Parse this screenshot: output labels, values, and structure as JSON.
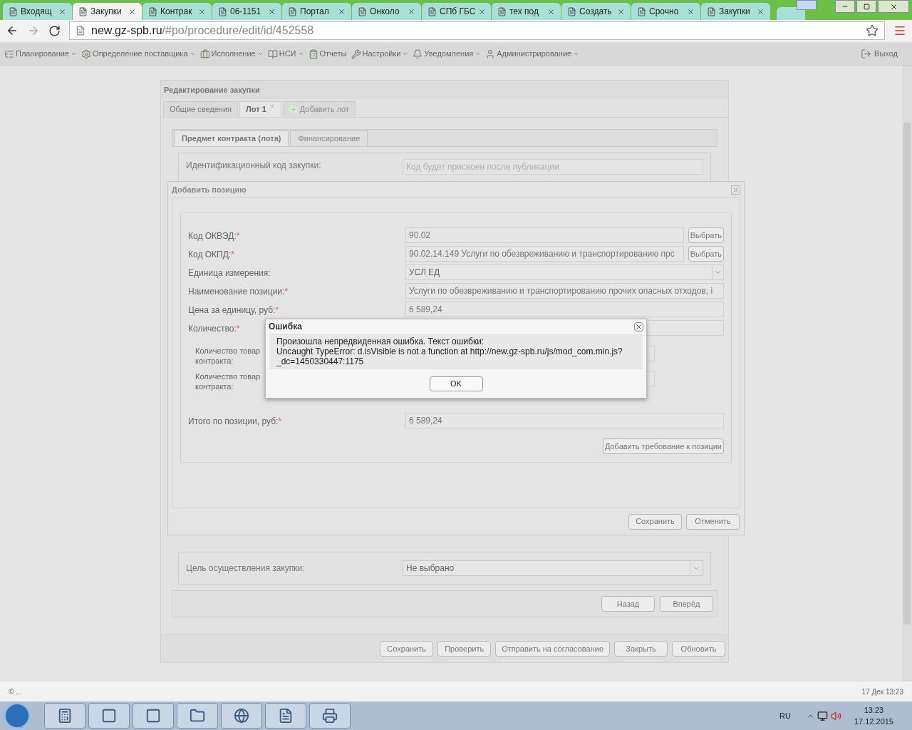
{
  "browser": {
    "tabs": [
      {
        "label": "Входящ",
        "selected": false
      },
      {
        "label": "Закупки",
        "selected": true
      },
      {
        "label": "Контрак",
        "selected": false
      },
      {
        "label": "06-1151",
        "selected": false
      },
      {
        "label": "Портал",
        "selected": false
      },
      {
        "label": "Онколо",
        "selected": false
      },
      {
        "label": "СПб ГБС",
        "selected": false
      },
      {
        "label": "тех под",
        "selected": false
      },
      {
        "label": "Создать",
        "selected": false
      },
      {
        "label": "Срочно",
        "selected": false
      },
      {
        "label": "Закупки",
        "selected": false
      }
    ],
    "url_host": "new.gz-spb.ru",
    "url_path": "/#po/procedure/edit/id/452558"
  },
  "menu": {
    "items": [
      {
        "label": "Планирование",
        "dropdown": true
      },
      {
        "label": "Определение поставщика",
        "dropdown": true
      },
      {
        "label": "Исполнение",
        "dropdown": true
      },
      {
        "label": "НСИ",
        "dropdown": true
      },
      {
        "label": "Отчеты",
        "dropdown": false
      },
      {
        "label": "Настройки",
        "dropdown": true
      },
      {
        "label": "Уведомления",
        "dropdown": true
      },
      {
        "label": "Администрирование",
        "dropdown": true
      }
    ],
    "logout": "Выход"
  },
  "procurement": {
    "title": "Редактирование закупки",
    "tabs": [
      {
        "label": "Общие сведения",
        "kind": "tab",
        "selected": false
      },
      {
        "label": "Лот 1",
        "kind": "closable",
        "selected": true
      },
      {
        "label": "Добавить лот",
        "kind": "add",
        "selected": false
      }
    ],
    "subtabs": [
      {
        "label": "Предмет контракта (лота)",
        "selected": true
      },
      {
        "label": "Финансирование",
        "selected": false
      }
    ],
    "id_field": {
      "label": "Идентификационный код закупки:",
      "placeholder": "Код будет присвоен после публикации"
    },
    "purpose": {
      "label": "Цель осуществления закупки:",
      "value": "Не выбрано"
    },
    "nav_buttons": [
      "Назад",
      "Вперёд"
    ],
    "buttons": [
      "Сохранить",
      "Проверить",
      "Отправить на согласование",
      "Закрыть",
      "Обновить"
    ]
  },
  "add_position": {
    "title": "Добавить позицию",
    "fields": [
      {
        "kind": "pick",
        "label": "Код ОКВЭД:",
        "mark": "*",
        "value": "90.02",
        "button": "Выбрать"
      },
      {
        "kind": "pick",
        "label": "Код ОКПД:",
        "mark": "*",
        "value": "90.02.14.149 Услуги по обезвреживанию и транспортированию прс",
        "button": "Выбрать"
      },
      {
        "kind": "select",
        "label": "Единица измерения:",
        "value": "УСЛ ЕД"
      },
      {
        "kind": "text",
        "label": "Наименование позиции:",
        "mark": "*",
        "value": "Услуги по обезвреживанию и транспортированию прочих опасных отходов, і"
      },
      {
        "kind": "text",
        "label": "Цена за единицу, руб:",
        "mark": "*",
        "value": "6 589,24"
      },
      {
        "kind": "text",
        "label": "Количество:",
        "mark": "*"
      },
      {
        "kind": "sub",
        "label": "Количество товар",
        "label_2": "контракта:"
      },
      {
        "kind": "sub",
        "label": "Количество товар",
        "label_2": "контракта:"
      },
      {
        "kind": "total",
        "label": "Итого по позиции, руб:",
        "mark": "*",
        "value": "6 589,24"
      }
    ],
    "requirement_button": "Добавить требование к позиции",
    "buttons": [
      "Сохранить",
      "Отменить"
    ]
  },
  "error": {
    "title": "Ошибка",
    "intro": "Произошла непредвиденная ошибка. Текст ошибки:",
    "detail": "Uncaught TypeError: d.isVisible is not a function at http://new.gz-spb.ru/js/mod_com.min.js?",
    "detail_2": "_dc=1450330447:1175",
    "button": "OK"
  },
  "status": {
    "left": "© ...",
    "right": "17 Дек 13:23"
  },
  "taskbar": {
    "lang": "RU",
    "time": "13:23",
    "date": "17.12.2015"
  }
}
